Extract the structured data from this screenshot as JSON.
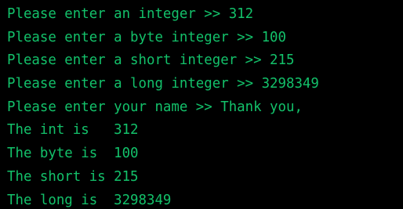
{
  "colors": {
    "background": "#000000",
    "text": "#13c16a"
  },
  "console": {
    "lines": [
      "Please enter an integer >> 312",
      "Please enter a byte integer >> 100",
      "Please enter a short integer >> 215",
      "Please enter a long integer >> 3298349",
      "Please enter your name >> Thank you,",
      "The int is   312",
      "The byte is  100",
      "The short is 215",
      "The long is  3298349"
    ]
  }
}
